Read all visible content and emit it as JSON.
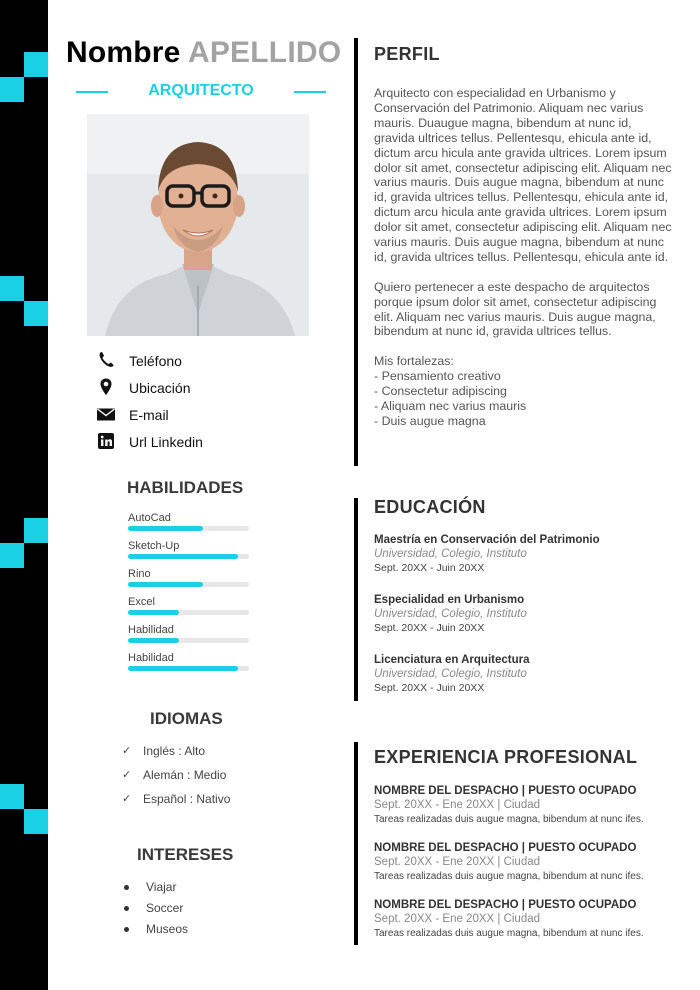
{
  "header": {
    "first_name": "Nombre",
    "last_name": "APELLIDO",
    "job_title": "ARQUITECTO"
  },
  "contacts": [
    {
      "icon": "phone-icon",
      "label": "Teléfono"
    },
    {
      "icon": "location-pin-icon",
      "label": "Ubicación"
    },
    {
      "icon": "email-icon",
      "label": "E-mail"
    },
    {
      "icon": "linkedin-icon",
      "label": "Url Linkedin"
    }
  ],
  "skills": {
    "title": "HABILIDADES",
    "items": [
      {
        "name": "AutoCad",
        "level": 0.62
      },
      {
        "name": "Sketch-Up",
        "level": 0.91
      },
      {
        "name": "Rino",
        "level": 0.62
      },
      {
        "name": "Excel",
        "level": 0.42
      },
      {
        "name": "Habilidad",
        "level": 0.42
      },
      {
        "name": "Habilidad",
        "level": 0.91
      }
    ]
  },
  "languages": {
    "title": "IDIOMAS",
    "items": [
      "Inglés : Alto",
      "Alemán : Medio",
      "Español : Nativo"
    ]
  },
  "interests": {
    "title": "INTERESES",
    "items": [
      "Viajar",
      "Soccer",
      "Museos"
    ]
  },
  "profile": {
    "title": "PERFIL",
    "paragraph1": "Arquitecto con especialidad en Urbanismo y Conservación del Patrimonio. Aliquam nec varius mauris. Duaugue magna, bibendum at nunc id, gravida ultrices tellus. Pellentesqu, ehicula ante id, dictum arcu hicula ante gravida ultrices. Lorem ipsum dolor sit amet, consectetur adipiscing elit. Aliquam nec varius mauris. Duis augue magna, bibendum at nunc id, gravida ultrices tellus. Pellentesqu, ehicula ante id, dictum arcu hicula ante gravida ultrices. Lorem ipsum dolor sit amet, consectetur adipiscing elit. Aliquam nec varius mauris. Duis augue magna, bibendum at nunc id, gravida ultrices tellus. Pellentesqu, ehicula ante id.",
    "paragraph2": "Quiero pertenecer a este despacho de arquitectos porque ipsum dolor sit amet, consectetur adipiscing elit. Aliquam nec varius mauris. Duis augue magna, bibendum at nunc id, gravida ultrices tellus.",
    "strengths_title": "Mis fortalezas:",
    "strengths": [
      "- Pensamiento creativo",
      "- Consectetur adipiscing",
      "- Aliquam nec varius mauris",
      "- Duis augue magna"
    ]
  },
  "education": {
    "title": "EDUCACIÓN",
    "items": [
      {
        "degree": "Maestría en Conservación del Patrimonio",
        "school": "Universidad, Colegio, Instituto",
        "dates": "Sept. 20XX - Juin 20XX"
      },
      {
        "degree": "Especialidad en Urbanismo",
        "school": "Universidad, Colegio, Instituto",
        "dates": "Sept. 20XX - Juin 20XX"
      },
      {
        "degree": "Licenciatura en Arquitectura",
        "school": "Universidad, Colegio, Instituto",
        "dates": "Sept. 20XX - Juin 20XX"
      }
    ]
  },
  "experience": {
    "title": "EXPERIENCIA PROFESIONAL",
    "items": [
      {
        "heading": "NOMBRE DEL DESPACHO | PUESTO OCUPADO",
        "meta": "Sept. 20XX - Ene 20XX | Ciudad",
        "desc": "Tareas realizadas duis augue magna, bibendum at nunc ifes."
      },
      {
        "heading": "NOMBRE DEL DESPACHO | PUESTO OCUPADO",
        "meta": "Sept. 20XX - Ene 20XX | Ciudad",
        "desc": "Tareas realizadas duis augue magna, bibendum at nunc ifes."
      },
      {
        "heading": "NOMBRE DEL DESPACHO | PUESTO OCUPADO",
        "meta": "Sept. 20XX - Ene 20XX | Ciudad",
        "desc": "Tareas realizadas duis augue magna, bibendum at nunc ifes."
      }
    ]
  },
  "colors": {
    "accent": "#1ad0e4",
    "stripe": "#000000",
    "text": "#333333",
    "muted": "#a3a3a3"
  }
}
